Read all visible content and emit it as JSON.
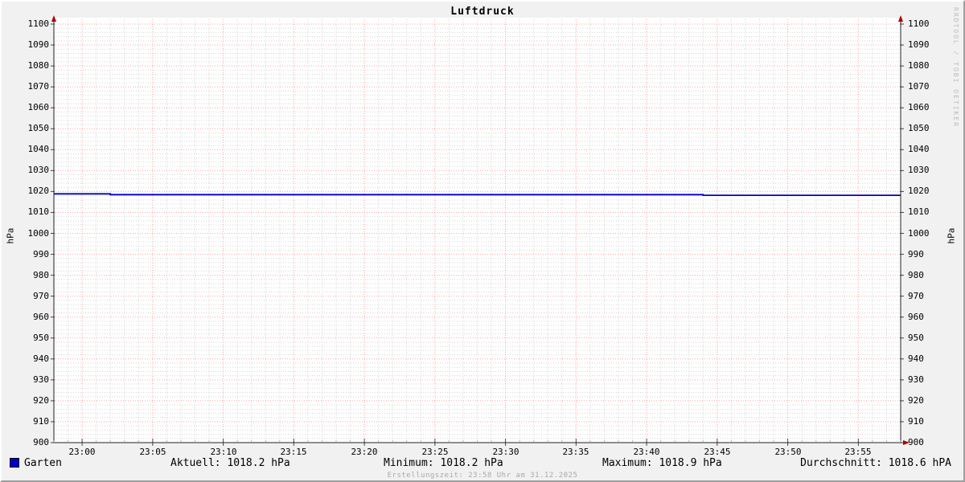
{
  "title": "Luftdruck",
  "chart_data": {
    "type": "line",
    "title": "Luftdruck",
    "ylabel_left": "hPa",
    "ylabel_right": "hPa",
    "ylim": [
      900,
      1100
    ],
    "y_major_step": 10,
    "y_minor_step": 2,
    "y_tick_labels": [
      "1100",
      "1090",
      "1080",
      "1070",
      "1060",
      "1050",
      "1040",
      "1030",
      "1020",
      "1010",
      "1000",
      "990",
      "980",
      "970",
      "960",
      "950",
      "940",
      "930",
      "920",
      "910",
      "900"
    ],
    "x_range": [
      "22:58",
      "23:58"
    ],
    "x_major_tick_labels": [
      "23:00",
      "23:05",
      "23:10",
      "23:15",
      "23:20",
      "23:25",
      "23:30",
      "23:35",
      "23:40",
      "23:45",
      "23:50",
      "23:55"
    ],
    "x_minor_step_minutes": 1,
    "x_major_step_minutes": 5,
    "grid": true,
    "legend_position": "bottom-left",
    "series": [
      {
        "name": "Garten",
        "color": "#0000cc",
        "points": [
          [
            "22:58",
            1018.9
          ],
          [
            "23:02",
            1018.9
          ],
          [
            "23:02",
            1018.5
          ],
          [
            "23:44",
            1018.5
          ],
          [
            "23:44",
            1018.2
          ],
          [
            "23:58",
            1018.2
          ]
        ]
      }
    ],
    "stats": {
      "aktuell": 1018.2,
      "minimum": 1018.2,
      "maximum": 1018.9,
      "durchschnitt": 1018.6
    }
  },
  "legend": {
    "series_label": "Garten",
    "aktuell": "Aktuell: 1018.2 hPa",
    "minimum": "Minimum: 1018.2 hPa",
    "maximum": "Maximum: 1018.9 hPa",
    "durchschnitt": "Durchschnitt: 1018.6 hPA"
  },
  "footer": {
    "erstellungszeit": "Erstellungszeit: 23:58 Uhr am 31.12.2025"
  },
  "watermark": "RRDTOOL / TOBI OETIKER",
  "colors": {
    "line": "#0000cc",
    "major_grid": "#ff0000",
    "minor_grid": "#bbbbbb",
    "axis": "#222222",
    "arrow": "#aa0000",
    "canvas": "#ffffff",
    "background": "#f1f1f1"
  }
}
